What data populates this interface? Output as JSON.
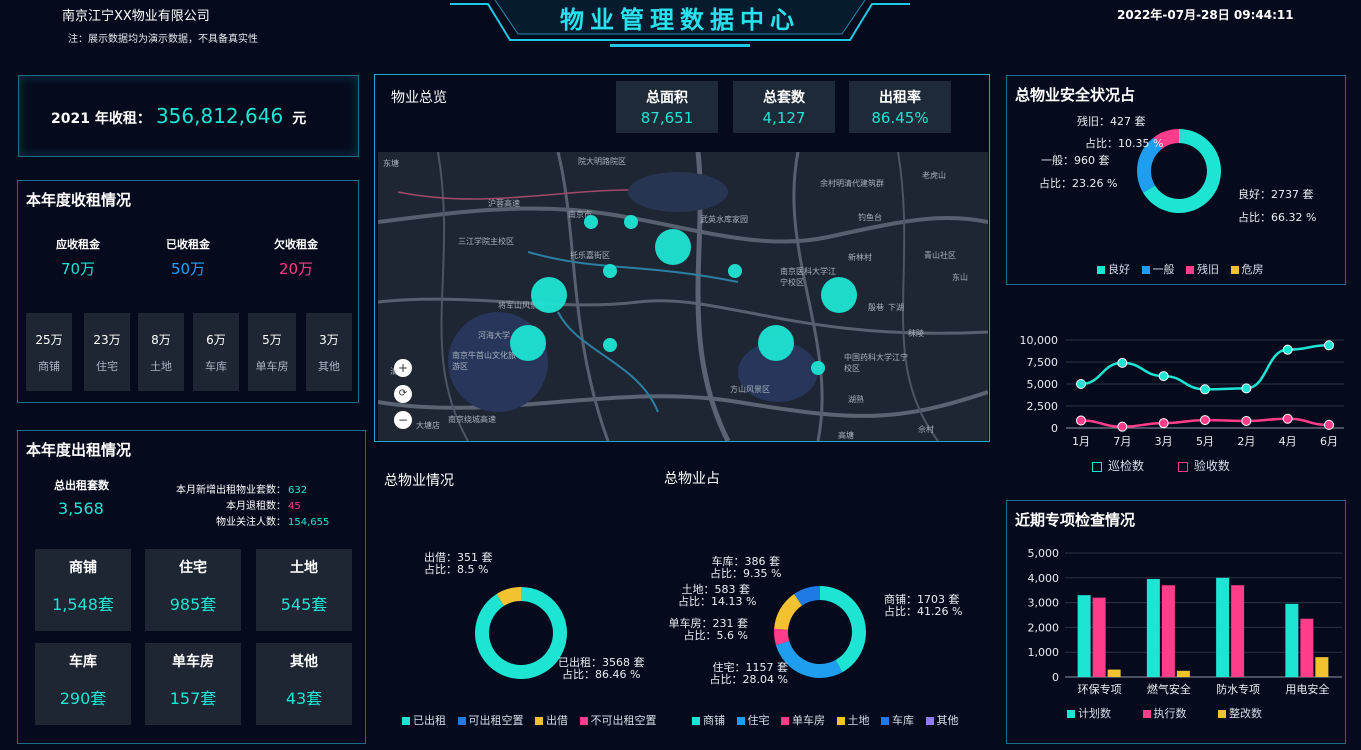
{
  "header": {
    "company": "南京江宁XX物业有限公司",
    "note": "注：展示数据均为演示数据，不具备真实性",
    "title": "物业管理数据中心",
    "datetime": "2022年-07月-28日 09:44:11"
  },
  "annual_rent": {
    "label": "2021 年收租：",
    "value": "356,812,646",
    "unit": "元"
  },
  "rent_collection": {
    "title": "本年度收租情况",
    "summary": [
      {
        "label": "应收租金",
        "value": "70万",
        "color": "#1ee4d4"
      },
      {
        "label": "已收租金",
        "value": "50万",
        "color": "#1fa3ff"
      },
      {
        "label": "欠收租金",
        "value": "20万",
        "color": "#ff3d8b"
      }
    ],
    "tiles": [
      {
        "value": "25万",
        "label": "商铺"
      },
      {
        "value": "23万",
        "label": "住宅"
      },
      {
        "value": "8万",
        "label": "土地"
      },
      {
        "value": "6万",
        "label": "车库"
      },
      {
        "value": "5万",
        "label": "单车房"
      },
      {
        "value": "3万",
        "label": "其他"
      }
    ]
  },
  "rental": {
    "title": "本年度出租情况",
    "total_label": "总出租套数",
    "total_value": "3,568",
    "stats": [
      {
        "label": "本月新增出租物业套数：",
        "value": "632",
        "color": "#1ee4d4"
      },
      {
        "label": "本月退租数：",
        "value": "45",
        "color": "#ff3d8b"
      },
      {
        "label": "物业关注人数：",
        "value": "154,655",
        "color": "#1ee4d4"
      }
    ],
    "tiles": [
      {
        "label": "商铺",
        "value": "1,548套"
      },
      {
        "label": "住宅",
        "value": "985套"
      },
      {
        "label": "土地",
        "value": "545套"
      },
      {
        "label": "车库",
        "value": "290套"
      },
      {
        "label": "单车房",
        "value": "157套"
      },
      {
        "label": "其他",
        "value": "43套"
      }
    ]
  },
  "overview": {
    "title": "物业总览",
    "kpis": [
      {
        "label": "总面积",
        "value": "87,651"
      },
      {
        "label": "总套数",
        "value": "4,127"
      },
      {
        "label": "出租率",
        "value": "86.45%"
      }
    ],
    "map_labels": [
      "院大明路院区",
      "南京市",
      "武英水库家园",
      "余村明清代建筑群",
      "老虎山",
      "沪蓉高速",
      "钓鱼台",
      "三江学院主校区",
      "托乐嘉街区",
      "新林村",
      "青山社区",
      "南京医科大学江宁校区",
      "将军山风景区",
      "河海大学",
      "南京牛首山文化旅游区",
      "中国药科大学江宁校区",
      "方山风景区",
      "南京绕城高速",
      "大塘店",
      "东山",
      "秣陵",
      "殷巷",
      "湖熟",
      "下湖",
      "佘村",
      "清风",
      "高塘",
      "东塘"
    ],
    "map_controls": {
      "zoom_in": "+",
      "reset": "⟳",
      "zoom_out": "−"
    }
  },
  "total_property": {
    "title": "总物业情况",
    "chart_data": {
      "type": "pie",
      "categories": [
        "已出租",
        "可出租空置",
        "出借",
        "不可出租空置"
      ],
      "values": [
        3568,
        0,
        351,
        0
      ],
      "colors": [
        "#1ee4d4",
        "#1f7ae6",
        "#f2c230",
        "#ff3d8b"
      ],
      "annotations": [
        {
          "name": "出借",
          "count": "351 套",
          "ratio": "8.5 %"
        },
        {
          "name": "已出租",
          "count": "3568 套",
          "ratio": "86.46 %"
        }
      ],
      "count_label": "出借：351 套",
      "ratio_label": "占比：8.5 %",
      "count_label2": "已出租：3568 套",
      "ratio_label2": "占比：86.46 %"
    }
  },
  "property_share": {
    "title": "总物业占",
    "chart_data": {
      "type": "pie",
      "categories": [
        "商铺",
        "住宅",
        "单车房",
        "土地",
        "车库",
        "其他"
      ],
      "values": [
        1703,
        1157,
        231,
        583,
        386,
        0
      ],
      "colors": [
        "#1ee4d4",
        "#1f9ef0",
        "#ff3d8b",
        "#f2c230",
        "#1f7ae6",
        "#8f7df0"
      ],
      "labels": [
        {
          "name": "商铺",
          "count": "1703 套",
          "ratio": "41.26 %"
        },
        {
          "name": "住宅",
          "count": "1157 套",
          "ratio": "28.04 %"
        },
        {
          "name": "单车房",
          "count": "231 套",
          "ratio": "5.6 %"
        },
        {
          "name": "土地",
          "count": "583 套",
          "ratio": "14.13 %"
        },
        {
          "name": "车库",
          "count": "386 套",
          "ratio": "9.35 %"
        }
      ]
    }
  },
  "safety": {
    "title": "总物业安全状况占",
    "chart_data": {
      "type": "pie",
      "categories": [
        "良好",
        "一般",
        "残旧",
        "危房"
      ],
      "values": [
        2737,
        960,
        427,
        0
      ],
      "colors": [
        "#1ee4d4",
        "#1f9ef0",
        "#ff3d8b",
        "#f2c230"
      ],
      "labels": [
        {
          "name": "残旧",
          "count": "427 套",
          "ratio": "10.35 %"
        },
        {
          "name": "一般",
          "count": "960 套",
          "ratio": "23.26 %"
        },
        {
          "name": "良好",
          "count": "2737 套",
          "ratio": "66.32 %"
        }
      ]
    }
  },
  "inspection_line": {
    "chart_data": {
      "type": "line",
      "categories": [
        "1月",
        "7月",
        "3月",
        "5月",
        "2月",
        "4月",
        "6月"
      ],
      "ylim": [
        0,
        10000
      ],
      "yticks": [
        "10,000",
        "7,500",
        "5,000",
        "2,500",
        "0"
      ],
      "series": [
        {
          "name": "巡检数",
          "color": "#1ee4d4",
          "values": [
            5000,
            7400,
            5900,
            4400,
            4500,
            8900,
            9400
          ]
        },
        {
          "name": "验收数",
          "color": "#ff3d8b",
          "values": [
            850,
            150,
            550,
            900,
            800,
            1050,
            350
          ]
        }
      ]
    }
  },
  "special_inspection": {
    "title": "近期专项检查情况",
    "chart_data": {
      "type": "bar",
      "categories": [
        "环保专项",
        "燃气安全",
        "防水专项",
        "用电安全"
      ],
      "ylim": [
        0,
        5000
      ],
      "yticks": [
        "5,000",
        "4,000",
        "3,000",
        "2,000",
        "1,000",
        "0"
      ],
      "series": [
        {
          "name": "计划数",
          "color": "#1ee4d4",
          "values": [
            3300,
            3950,
            4000,
            2950
          ]
        },
        {
          "name": "执行数",
          "color": "#ff3d8b",
          "values": [
            3200,
            3700,
            3700,
            2350
          ]
        },
        {
          "name": "整改数",
          "color": "#f2c230",
          "values": [
            300,
            250,
            0,
            800
          ]
        }
      ]
    }
  }
}
